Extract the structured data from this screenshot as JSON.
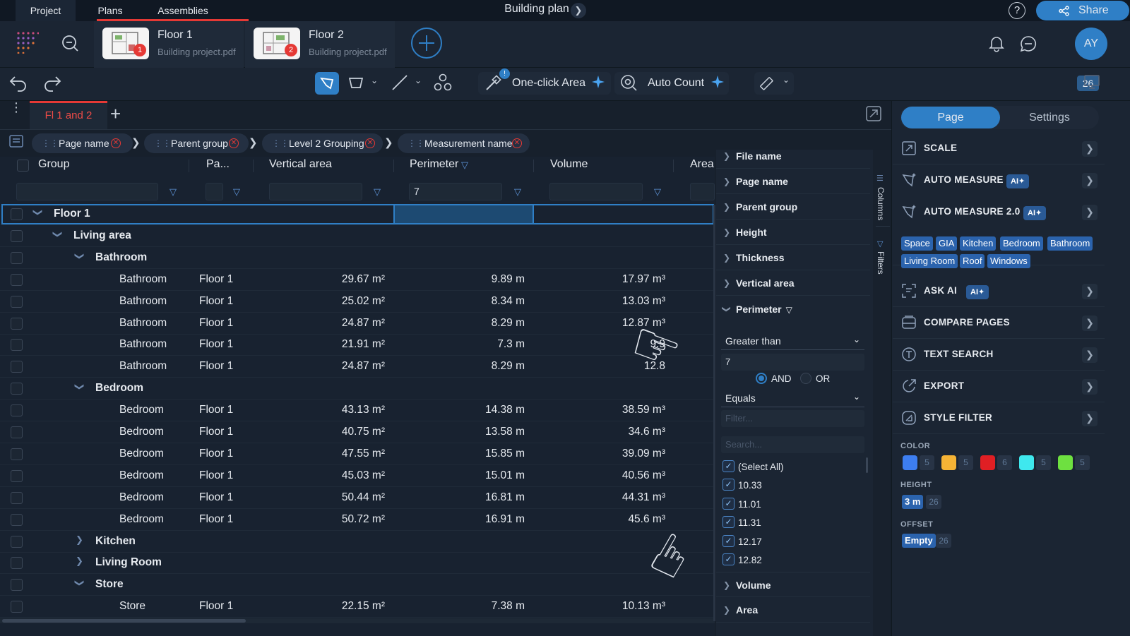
{
  "top_tabs": [
    "Project",
    "Plans",
    "Assemblies"
  ],
  "document_title": "Building plan",
  "help_icon": "?",
  "share_label": "Share",
  "files": [
    {
      "name": "Floor 1",
      "source": "Building project.pdf",
      "badge": "1"
    },
    {
      "name": "Floor 2",
      "source": "Building project.pdf",
      "badge": "2"
    }
  ],
  "user_initials": "AY",
  "toolbar": {
    "one_click_area": "One-click Area",
    "auto_count": "Auto Count",
    "notice_badge": "!",
    "page_count": "26"
  },
  "tab": {
    "label": "Fl 1 and 2"
  },
  "grouping_chips": [
    "Page name",
    "Parent group",
    "Level 2 Grouping",
    "Measurement name"
  ],
  "grid": {
    "headers": [
      "Group",
      "Pa...",
      "Vertical area",
      "Perimeter",
      "Volume",
      "Area"
    ],
    "perimeter_filter_value": "7",
    "rows": [
      {
        "level": 0,
        "type": "group",
        "label": "Floor 1",
        "expanded": true
      },
      {
        "level": 1,
        "type": "group",
        "label": "Living area",
        "expanded": true
      },
      {
        "level": 2,
        "type": "group",
        "label": "Bathroom",
        "expanded": true
      },
      {
        "level": 3,
        "type": "data",
        "label": "Bathroom",
        "page": "Floor 1",
        "vertical_area": "29.67 m²",
        "perimeter": "9.89 m",
        "volume": "17.97 m³"
      },
      {
        "level": 3,
        "type": "data",
        "label": "Bathroom",
        "page": "Floor 1",
        "vertical_area": "25.02 m²",
        "perimeter": "8.34 m",
        "volume": "13.03 m³"
      },
      {
        "level": 3,
        "type": "data",
        "label": "Bathroom",
        "page": "Floor 1",
        "vertical_area": "24.87 m²",
        "perimeter": "8.29 m",
        "volume": "12.87 m³"
      },
      {
        "level": 3,
        "type": "data",
        "label": "Bathroom",
        "page": "Floor 1",
        "vertical_area": "21.91 m²",
        "perimeter": "7.3 m",
        "volume": "9.9"
      },
      {
        "level": 3,
        "type": "data",
        "label": "Bathroom",
        "page": "Floor 1",
        "vertical_area": "24.87 m²",
        "perimeter": "8.29 m",
        "volume": "12.8"
      },
      {
        "level": 2,
        "type": "group",
        "label": "Bedroom",
        "expanded": true
      },
      {
        "level": 3,
        "type": "data",
        "label": "Bedroom",
        "page": "Floor 1",
        "vertical_area": "43.13 m²",
        "perimeter": "14.38 m",
        "volume": "38.59 m³"
      },
      {
        "level": 3,
        "type": "data",
        "label": "Bedroom",
        "page": "Floor 1",
        "vertical_area": "40.75 m²",
        "perimeter": "13.58 m",
        "volume": "34.6 m³"
      },
      {
        "level": 3,
        "type": "data",
        "label": "Bedroom",
        "page": "Floor 1",
        "vertical_area": "47.55 m²",
        "perimeter": "15.85 m",
        "volume": "39.09 m³"
      },
      {
        "level": 3,
        "type": "data",
        "label": "Bedroom",
        "page": "Floor 1",
        "vertical_area": "45.03 m²",
        "perimeter": "15.01 m",
        "volume": "40.56 m³"
      },
      {
        "level": 3,
        "type": "data",
        "label": "Bedroom",
        "page": "Floor 1",
        "vertical_area": "50.44 m²",
        "perimeter": "16.81 m",
        "volume": "44.31 m³"
      },
      {
        "level": 3,
        "type": "data",
        "label": "Bedroom",
        "page": "Floor 1",
        "vertical_area": "50.72 m²",
        "perimeter": "16.91 m",
        "volume": "45.6 m³"
      },
      {
        "level": 2,
        "type": "group",
        "label": "Kitchen",
        "expanded": false
      },
      {
        "level": 2,
        "type": "group",
        "label": "Living Room",
        "expanded": false
      },
      {
        "level": 2,
        "type": "group",
        "label": "Store",
        "expanded": true
      },
      {
        "level": 3,
        "type": "data",
        "label": "Store",
        "page": "Floor 1",
        "vertical_area": "22.15 m²",
        "perimeter": "7.38 m",
        "volume": "10.13 m³"
      }
    ]
  },
  "column_panel": {
    "items_top": [
      "File name",
      "Page name",
      "Parent group",
      "Height",
      "Thickness",
      "Vertical area"
    ],
    "active_filter": "Perimeter",
    "condition_1": "Greater than",
    "value_1": "7",
    "and_label": "AND",
    "or_label": "OR",
    "logic_selected": "AND",
    "condition_2": "Equals",
    "value_2_placeholder": "Filter...",
    "search_placeholder": "Search...",
    "values": [
      "(Select All)",
      "10.33",
      "11.01",
      "11.31",
      "12.17",
      "12.82"
    ],
    "items_bottom": [
      "Volume",
      "Area"
    ],
    "side_tabs": [
      "Columns",
      "Filters"
    ]
  },
  "right_panel": {
    "tabs": [
      "Page",
      "Settings"
    ],
    "active_tab": "Page",
    "items": [
      {
        "label": "SCALE",
        "ai": false
      },
      {
        "label": "AUTO MEASURE",
        "ai": true
      },
      {
        "label": "AUTO MEASURE 2.0",
        "ai": true
      },
      {
        "label": "ASK AI",
        "ai": true
      },
      {
        "label": "COMPARE PAGES",
        "ai": false
      },
      {
        "label": "TEXT SEARCH",
        "ai": false
      },
      {
        "label": "EXPORT",
        "ai": false
      },
      {
        "label": "STYLE FILTER",
        "ai": false
      }
    ],
    "ai_badge": "AI",
    "auto_measure_tags": [
      "Space",
      "GIA",
      "Kitchen",
      "Bedroom",
      "Bathroom",
      "Living Room",
      "Roof",
      "Windows"
    ],
    "style_filter": {
      "color_label": "COLOR",
      "colors": [
        {
          "hex": "#3d7ef0",
          "count": "5"
        },
        {
          "hex": "#f5b335",
          "count": "5"
        },
        {
          "hex": "#e01f24",
          "count": "6"
        },
        {
          "hex": "#3fe8ee",
          "count": "5"
        },
        {
          "hex": "#6ee040",
          "count": "5"
        }
      ],
      "height_label": "HEIGHT",
      "height_value": "3 m",
      "height_count": "26",
      "offset_label": "OFFSET",
      "offset_value": "Empty",
      "offset_count": "26"
    }
  },
  "colors": {
    "accent": "#2f7fc6",
    "alert": "#e53935",
    "background": "#17202c"
  }
}
